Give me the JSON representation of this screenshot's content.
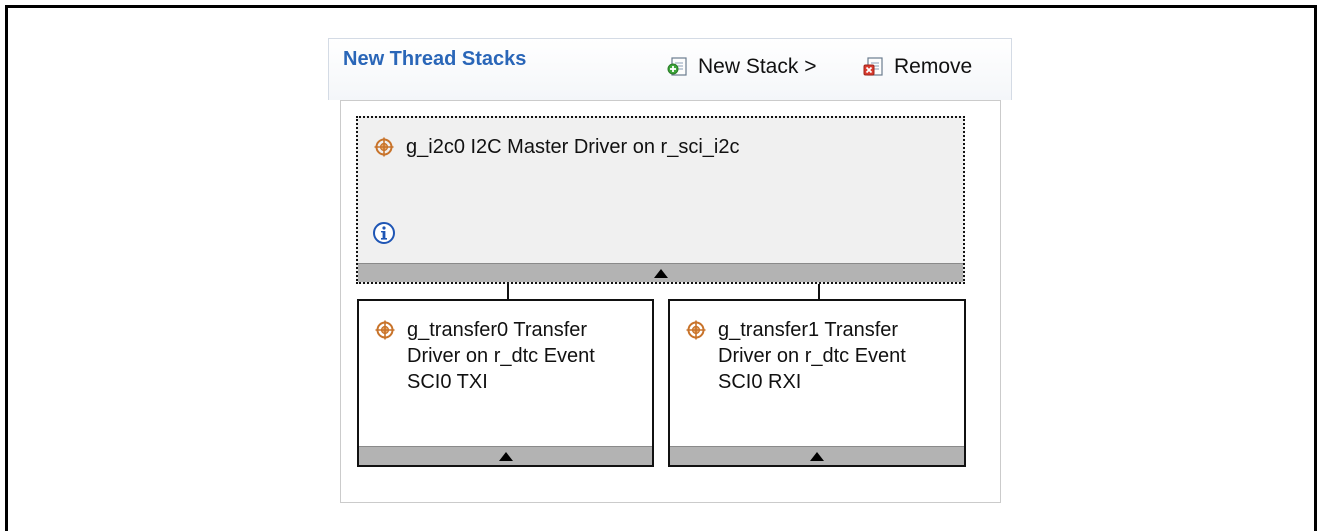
{
  "panel": {
    "title": "New Thread Stacks",
    "toolbar": {
      "new_stack_label": "New Stack >",
      "remove_label": "Remove"
    }
  },
  "stacks": {
    "root": {
      "label": "g_i2c0 I2C Master Driver on r_sci_i2c"
    },
    "children": [
      {
        "label": "g_transfer0 Transfer\nDriver on r_dtc Event\nSCI0 TXI"
      },
      {
        "label": "g_transfer1 Transfer\nDriver on r_dtc Event\nSCI0 RXI"
      }
    ]
  },
  "icons": {
    "stack_icon": "crosshair-target-icon",
    "info": "info-icon",
    "new_stack": "new-stack-icon",
    "remove": "remove-icon"
  },
  "colors": {
    "title_blue": "#2a66b8",
    "target_orange": "#c8732a",
    "selected_bg": "#f0f0f0",
    "collapse_bar": "#b3b3b3"
  }
}
